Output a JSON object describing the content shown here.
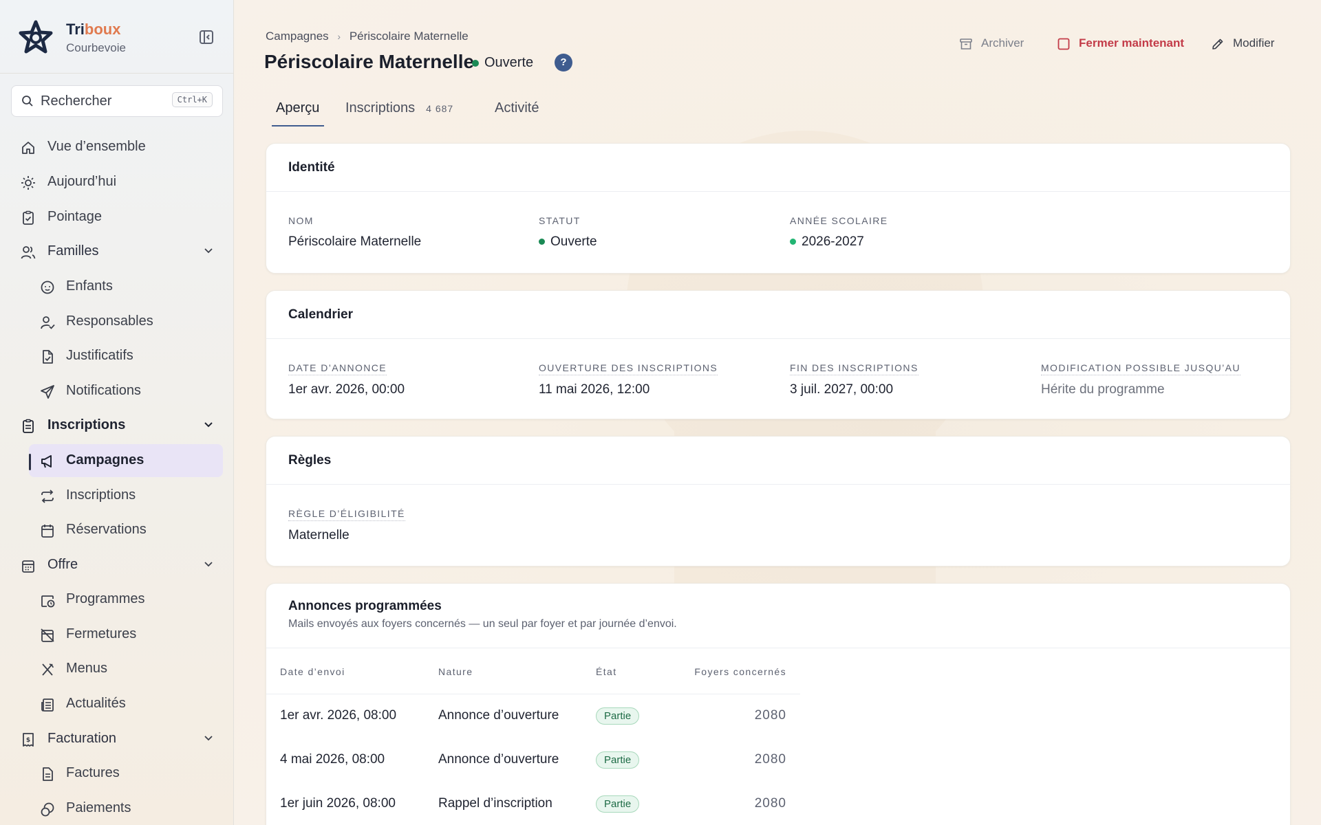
{
  "brand": {
    "name_a": "Tri",
    "name_b": "boux",
    "city": "Courbevoie"
  },
  "search": {
    "placeholder": "Rechercher",
    "shortcut": "Ctrl+K"
  },
  "sidebar": {
    "items": [
      {
        "label": "Vue d’ensemble",
        "icon": "home-icon"
      },
      {
        "label": "Aujourd’hui",
        "icon": "sun-icon"
      },
      {
        "label": "Pointage",
        "icon": "clipboard-check-icon"
      },
      {
        "label": "Familles",
        "icon": "users-icon"
      },
      {
        "label": "Enfants",
        "icon": "baby-icon"
      },
      {
        "label": "Responsables",
        "icon": "user-check-icon"
      },
      {
        "label": "Justificatifs",
        "icon": "file-check-icon"
      },
      {
        "label": "Notifications",
        "icon": "send-icon"
      },
      {
        "label": "Inscriptions",
        "icon": "clipboard-list-icon"
      },
      {
        "label": "Campagnes",
        "icon": "megaphone-icon"
      },
      {
        "label": "Inscriptions",
        "icon": "repeat-icon"
      },
      {
        "label": "Réservations",
        "icon": "calendar-icon"
      },
      {
        "label": "Offre",
        "icon": "calendar-days-icon"
      },
      {
        "label": "Programmes",
        "icon": "calendar-clock-icon"
      },
      {
        "label": "Fermetures",
        "icon": "calendar-off-icon"
      },
      {
        "label": "Menus",
        "icon": "utensils-icon"
      },
      {
        "label": "Actualités",
        "icon": "newspaper-icon"
      },
      {
        "label": "Facturation",
        "icon": "receipt-icon"
      },
      {
        "label": "Factures",
        "icon": "file-text-icon"
      },
      {
        "label": "Paiements",
        "icon": "coins-icon"
      }
    ]
  },
  "breadcrumb": {
    "parent": "Campagnes",
    "current": "Périscolaire Maternelle"
  },
  "page": {
    "title": "Périscolaire Maternelle",
    "status": "Ouverte",
    "help": "?"
  },
  "actions": {
    "archive": "Archiver",
    "close": "Fermer maintenant",
    "edit": "Modifier"
  },
  "tabs": [
    {
      "label": "Aperçu"
    },
    {
      "label": "Inscriptions",
      "count": "4 687"
    },
    {
      "label": "Activité"
    }
  ],
  "identity": {
    "title": "Identité",
    "name_label": "Nom",
    "name_value": "Périscolaire Maternelle",
    "status_label": "Statut",
    "status_value": "Ouverte",
    "year_label": "Année scolaire",
    "year_value": "2026-2027"
  },
  "calendar": {
    "title": "Calendrier",
    "fields": [
      {
        "label": "Date d’annonce",
        "value": "1er avr. 2026, 00:00"
      },
      {
        "label": "Ouverture des inscriptions",
        "value": "11 mai 2026, 12:00"
      },
      {
        "label": "Fin des inscriptions",
        "value": "3 juil. 2027, 00:00"
      },
      {
        "label": "Modification possible jusqu’au",
        "value": "Hérite du programme"
      }
    ]
  },
  "rules": {
    "title": "Règles",
    "label": "Règle d’éligibilité",
    "value": "Maternelle"
  },
  "announcements": {
    "title": "Annonces programmées",
    "description": "Mails envoyés aux foyers concernés — un seul par foyer et par journée d’envoi.",
    "columns": [
      "Date d’envoi",
      "Nature",
      "État",
      "Foyers concernés"
    ],
    "rows": [
      {
        "date": "1er avr. 2026, 08:00",
        "nature": "Annonce d’ouverture",
        "state": "Partie",
        "count": "2080"
      },
      {
        "date": "4 mai 2026, 08:00",
        "nature": "Annonce d’ouverture",
        "state": "Partie",
        "count": "2080"
      },
      {
        "date": "1er juin 2026, 08:00",
        "nature": "Rappel d’inscription",
        "state": "Partie",
        "count": "2080"
      }
    ]
  },
  "colors": {
    "accent": "#3f5c8f",
    "danger": "#c33b48",
    "success": "#1b8a55",
    "active_bg": "#e9e4f6"
  }
}
